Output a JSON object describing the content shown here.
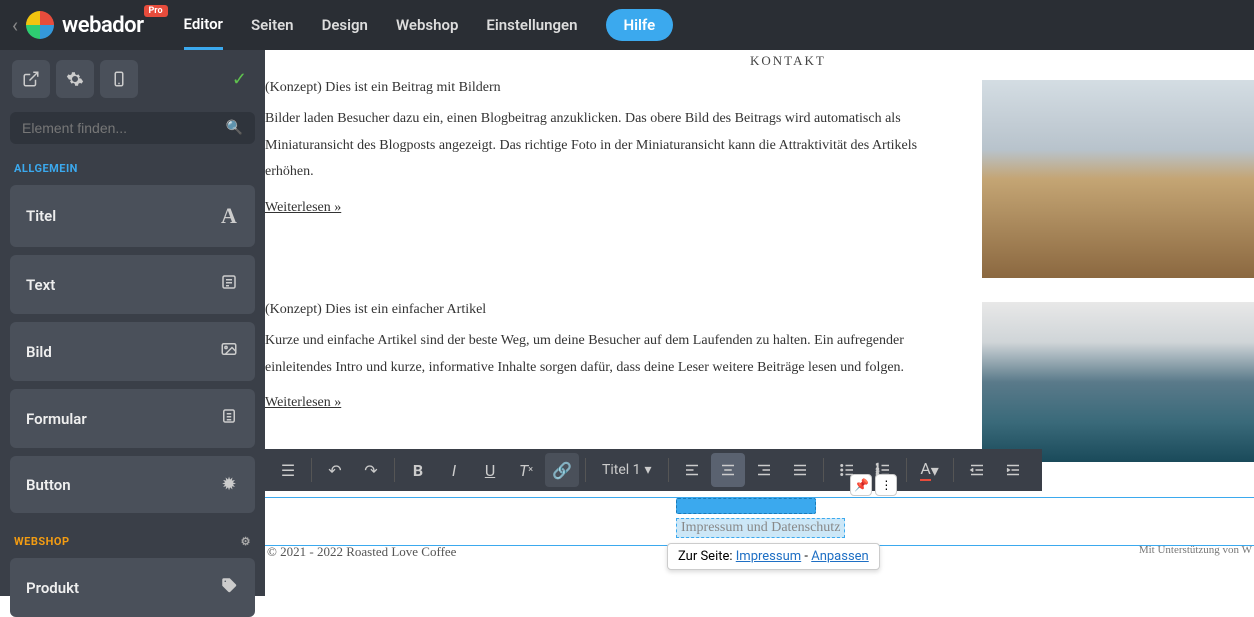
{
  "brand": {
    "name": "webador",
    "badge": "Pro"
  },
  "topnav": {
    "items": [
      "Editor",
      "Seiten",
      "Design",
      "Webshop",
      "Einstellungen"
    ],
    "help": "Hilfe",
    "active": 0
  },
  "sidebar": {
    "search_placeholder": "Element finden...",
    "sections": {
      "allgemein": {
        "label": "ALLGEMEIN",
        "items": [
          {
            "label": "Titel",
            "icon": "type"
          },
          {
            "label": "Text",
            "icon": "text"
          },
          {
            "label": "Bild",
            "icon": "image"
          },
          {
            "label": "Formular",
            "icon": "form"
          },
          {
            "label": "Button",
            "icon": "burst"
          }
        ]
      },
      "webshop": {
        "label": "WEBSHOP",
        "items": [
          {
            "label": "Produkt",
            "icon": "tag"
          }
        ]
      }
    }
  },
  "canvas": {
    "nav_item": "KONTAKT",
    "articles": [
      {
        "title": "(Konzept) Dies ist ein Beitrag mit Bildern",
        "body": "Bilder laden Besucher dazu ein, einen Blogbeitrag anzuklicken. Das obere Bild des Beitrags wird automatisch als Miniaturansicht des Blogposts angezeigt. Das richtige Foto in der Miniaturansicht kann die Attraktivität des Artikels erhöhen.",
        "readmore": "Weiterlesen »"
      },
      {
        "title": "(Konzept) Dies ist ein einfacher Artikel",
        "body": "Kurze und einfache Artikel sind der beste Weg, um deine Besucher auf dem Laufenden zu halten. Ein aufregender einleitendes Intro und kurze, informative Inhalte sorgen dafür, dass deine Leser weitere Beiträge lesen und folgen.",
        "readmore": "Weiterlesen »"
      }
    ],
    "editor_toolbar": {
      "heading_dropdown": "Titel 1"
    },
    "selected_text": "Impressum und Datenschutz",
    "tooltip": {
      "prefix": "Zur Seite: ",
      "link": "Impressum",
      "sep": " - ",
      "action": "Anpassen"
    },
    "footer": {
      "left": "© 2021 - 2022 Roasted Love Coffee",
      "right": "Mit Unterstützung von W"
    }
  }
}
